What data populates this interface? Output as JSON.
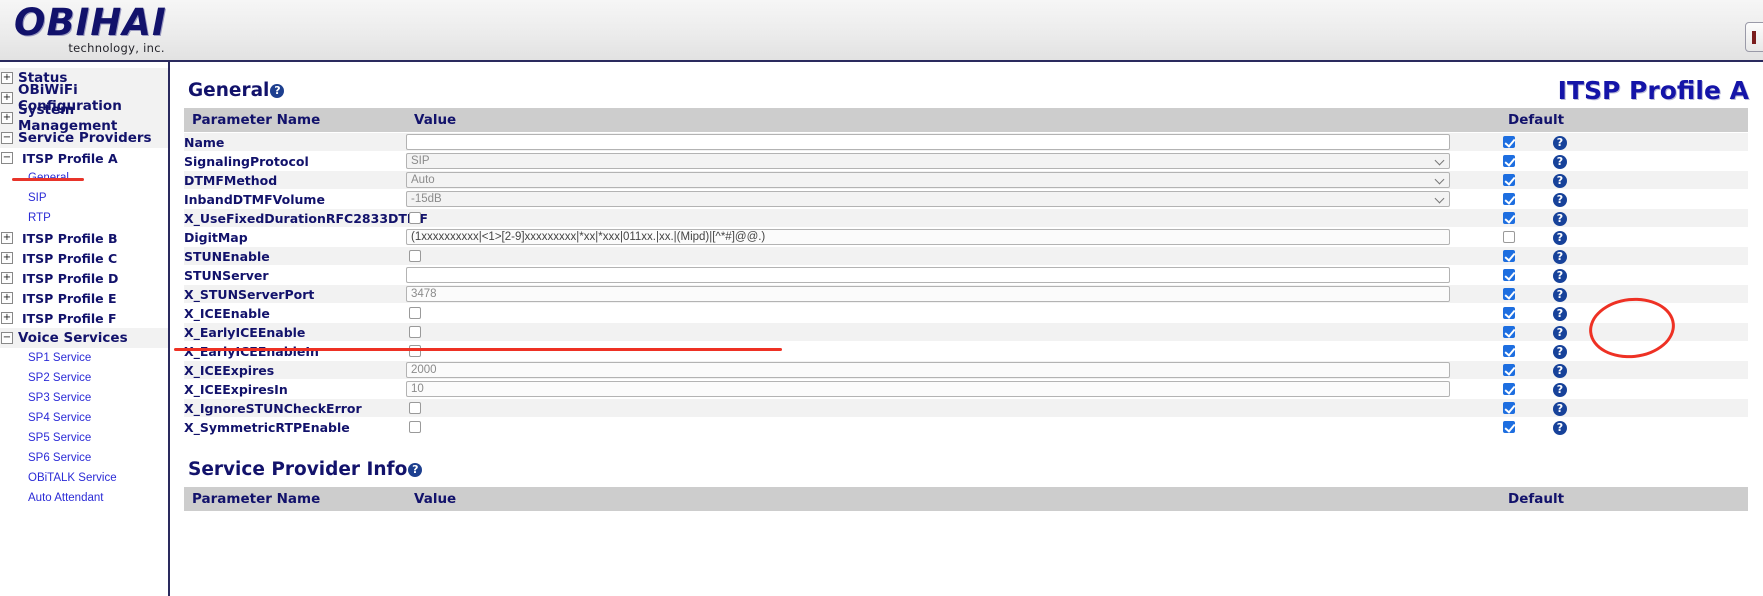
{
  "brand": {
    "name": "OBIHAI",
    "tagline": "technology, inc."
  },
  "page": {
    "title": "ITSP Profile A"
  },
  "sidebar": {
    "items": [
      {
        "label": "Status",
        "toggle": "+",
        "level": 1
      },
      {
        "label": "OBiWiFi Configuration",
        "toggle": "+",
        "level": 1
      },
      {
        "label": "System Management",
        "toggle": "+",
        "level": 1
      },
      {
        "label": "Service Providers",
        "toggle": "−",
        "level": 1
      },
      {
        "label": "ITSP Profile A",
        "toggle": "−",
        "level": 2
      },
      {
        "label": "General",
        "toggle": "",
        "level": 3
      },
      {
        "label": "SIP",
        "toggle": "",
        "level": 3
      },
      {
        "label": "RTP",
        "toggle": "",
        "level": 3
      },
      {
        "label": "ITSP Profile B",
        "toggle": "+",
        "level": 2
      },
      {
        "label": "ITSP Profile C",
        "toggle": "+",
        "level": 2
      },
      {
        "label": "ITSP Profile D",
        "toggle": "+",
        "level": 2
      },
      {
        "label": "ITSP Profile E",
        "toggle": "+",
        "level": 2
      },
      {
        "label": "ITSP Profile F",
        "toggle": "+",
        "level": 2
      },
      {
        "label": "Voice Services",
        "toggle": "−",
        "level": 1
      },
      {
        "label": "SP1 Service",
        "toggle": "",
        "level": 3
      },
      {
        "label": "SP2 Service",
        "toggle": "",
        "level": 3
      },
      {
        "label": "SP3 Service",
        "toggle": "",
        "level": 3
      },
      {
        "label": "SP4 Service",
        "toggle": "",
        "level": 3
      },
      {
        "label": "SP5 Service",
        "toggle": "",
        "level": 3
      },
      {
        "label": "SP6 Service",
        "toggle": "",
        "level": 3
      },
      {
        "label": "OBiTALK Service",
        "toggle": "",
        "level": 3
      },
      {
        "label": "Auto Attendant",
        "toggle": "",
        "level": 3
      }
    ]
  },
  "sections": [
    {
      "title": "General",
      "help_glyph": "?",
      "columns": {
        "name": "Parameter Name",
        "value": "Value",
        "default": "Default"
      },
      "rows": [
        {
          "name": "Name",
          "kind": "text",
          "value": "",
          "default": true
        },
        {
          "name": "SignalingProtocol",
          "kind": "select",
          "value": "SIP",
          "default": true
        },
        {
          "name": "DTMFMethod",
          "kind": "select",
          "value": "Auto",
          "default": true
        },
        {
          "name": "InbandDTMFVolume",
          "kind": "select",
          "value": "-15dB",
          "default": true
        },
        {
          "name": "X_UseFixedDurationRFC2833DTMF",
          "kind": "checkbox",
          "value": false,
          "default": true
        },
        {
          "name": "DigitMap",
          "kind": "text",
          "value": "(1xxxxxxxxxx|<1>[2-9]xxxxxxxxx|*xx|*xxx|011xx.|xx.|(Mipd)|[^*#]@@.)",
          "default": false
        },
        {
          "name": "STUNEnable",
          "kind": "checkbox",
          "value": false,
          "default": true
        },
        {
          "name": "STUNServer",
          "kind": "text",
          "value": "",
          "default": true
        },
        {
          "name": "X_STUNServerPort",
          "kind": "text",
          "value": "3478",
          "default": true
        },
        {
          "name": "X_ICEEnable",
          "kind": "checkbox",
          "value": false,
          "default": true
        },
        {
          "name": "X_EarlyICEEnable",
          "kind": "checkbox",
          "value": false,
          "default": true
        },
        {
          "name": "X_EarlyICEEnableIn",
          "kind": "checkbox",
          "value": false,
          "default": true
        },
        {
          "name": "X_ICEExpires",
          "kind": "text",
          "value": "2000",
          "default": true
        },
        {
          "name": "X_ICEExpiresIn",
          "kind": "text",
          "value": "10",
          "default": true
        },
        {
          "name": "X_IgnoreSTUNCheckError",
          "kind": "checkbox",
          "value": false,
          "default": true
        },
        {
          "name": "X_SymmetricRTPEnable",
          "kind": "checkbox",
          "value": false,
          "default": true
        }
      ]
    },
    {
      "title": "Service Provider Info",
      "help_glyph": "?",
      "columns": {
        "name": "Parameter Name",
        "value": "Value",
        "default": "Default"
      },
      "rows": []
    }
  ],
  "annotations": {
    "sidebar_underline_target": "General",
    "circle_target": "DigitMap default checkbox",
    "line_target": "DigitMap row",
    "color": "#ee3124"
  }
}
